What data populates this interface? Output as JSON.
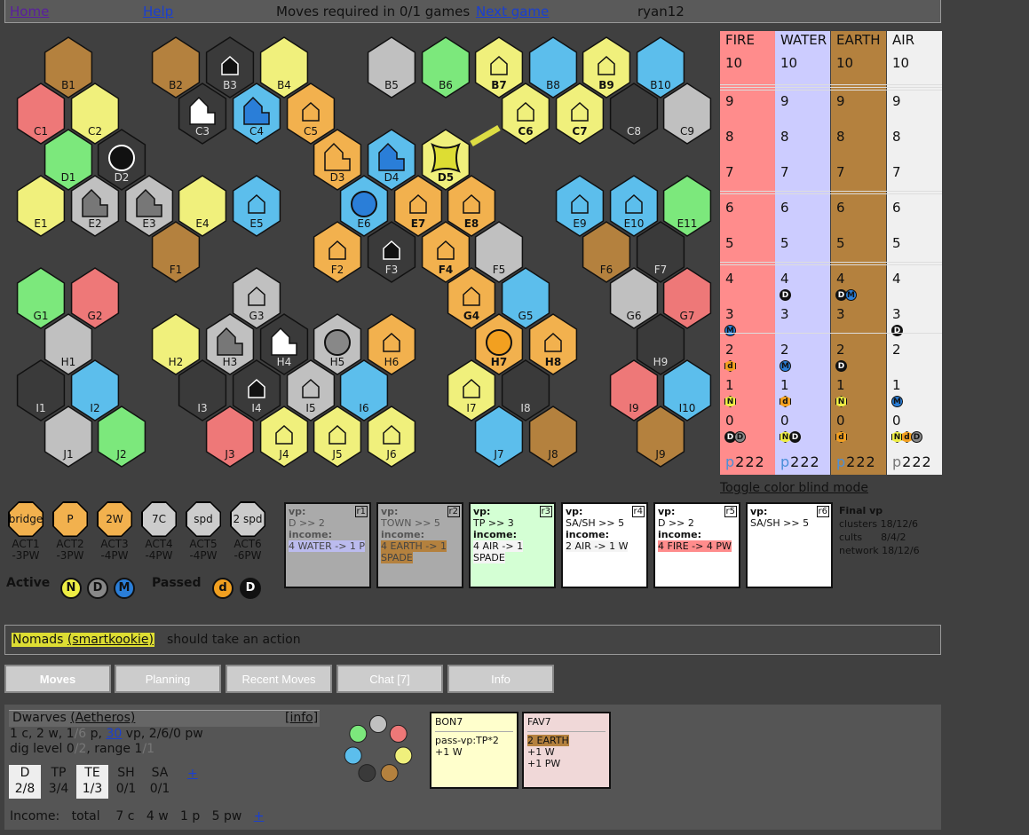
{
  "header": {
    "home": "Home",
    "help": "Help",
    "moves_required": "Moves required in 0/1 games",
    "next_game": "Next game",
    "user": "ryan12"
  },
  "colors": {
    "yellow": "#f0f07c",
    "gray": "#c0c0c0",
    "brown": "#b4813e",
    "black": "#3a3a3a",
    "blue": "#5cbeec",
    "green": "#7ce87c",
    "red": "#ee7878",
    "orange": "#f2b14e"
  },
  "map": {
    "hexes": [
      {
        "id": "B1",
        "c": "brown"
      },
      {
        "id": "B2",
        "c": "brown"
      },
      {
        "id": "B3",
        "c": "black",
        "b": "dwelling"
      },
      {
        "id": "B4",
        "c": "yellow"
      },
      {
        "id": "B5",
        "c": "gray"
      },
      {
        "id": "B6",
        "c": "green"
      },
      {
        "id": "B7",
        "c": "yellow",
        "b": "dwelling",
        "bold": true
      },
      {
        "id": "B8",
        "c": "blue"
      },
      {
        "id": "B9",
        "c": "yellow",
        "b": "dwelling",
        "bold": true
      },
      {
        "id": "B10",
        "c": "blue"
      },
      {
        "id": "C1",
        "c": "red"
      },
      {
        "id": "C2",
        "c": "yellow"
      },
      {
        "id": "C3",
        "c": "black",
        "b": "tp"
      },
      {
        "id": "C4",
        "c": "blue",
        "b": "tp"
      },
      {
        "id": "C5",
        "c": "orange",
        "b": "dwelling"
      },
      {
        "id": "C6",
        "c": "yellow",
        "b": "dwelling",
        "bold": true
      },
      {
        "id": "C7",
        "c": "yellow",
        "b": "dwelling",
        "bold": true
      },
      {
        "id": "C8",
        "c": "black"
      },
      {
        "id": "C9",
        "c": "gray"
      },
      {
        "id": "D1",
        "c": "green"
      },
      {
        "id": "D2",
        "c": "black",
        "b": "sh"
      },
      {
        "id": "D3",
        "c": "orange",
        "b": "tp"
      },
      {
        "id": "D4",
        "c": "blue",
        "b": "tp"
      },
      {
        "id": "D5",
        "c": "yellow",
        "b": "sa",
        "bold": true
      },
      {
        "id": "E1",
        "c": "yellow"
      },
      {
        "id": "E2",
        "c": "gray",
        "b": "tp"
      },
      {
        "id": "E3",
        "c": "gray",
        "b": "tp"
      },
      {
        "id": "E4",
        "c": "yellow"
      },
      {
        "id": "E5",
        "c": "blue",
        "b": "dwelling"
      },
      {
        "id": "E6",
        "c": "blue",
        "b": "sh"
      },
      {
        "id": "E7",
        "c": "orange",
        "b": "dwelling",
        "bold": true
      },
      {
        "id": "E8",
        "c": "orange",
        "b": "dwelling",
        "bold": true
      },
      {
        "id": "E9",
        "c": "blue",
        "b": "dwelling"
      },
      {
        "id": "E10",
        "c": "blue",
        "b": "dwelling"
      },
      {
        "id": "E11",
        "c": "green"
      },
      {
        "id": "F1",
        "c": "brown"
      },
      {
        "id": "F2",
        "c": "orange",
        "b": "dwelling"
      },
      {
        "id": "F3",
        "c": "black",
        "b": "dwelling"
      },
      {
        "id": "F4",
        "c": "orange",
        "b": "dwelling",
        "bold": true
      },
      {
        "id": "F5",
        "c": "gray"
      },
      {
        "id": "F6",
        "c": "brown"
      },
      {
        "id": "F7",
        "c": "black"
      },
      {
        "id": "G1",
        "c": "green"
      },
      {
        "id": "G2",
        "c": "red"
      },
      {
        "id": "G3",
        "c": "gray",
        "b": "dwelling"
      },
      {
        "id": "G4",
        "c": "orange",
        "b": "dwelling",
        "bold": true
      },
      {
        "id": "G5",
        "c": "blue"
      },
      {
        "id": "G6",
        "c": "gray"
      },
      {
        "id": "G7",
        "c": "red"
      },
      {
        "id": "H1",
        "c": "gray"
      },
      {
        "id": "H2",
        "c": "yellow"
      },
      {
        "id": "H3",
        "c": "gray",
        "b": "tp"
      },
      {
        "id": "H4",
        "c": "black",
        "b": "tp"
      },
      {
        "id": "H5",
        "c": "gray",
        "b": "sh"
      },
      {
        "id": "H6",
        "c": "orange",
        "b": "dwelling"
      },
      {
        "id": "H7",
        "c": "orange",
        "b": "sh",
        "bold": true
      },
      {
        "id": "H8",
        "c": "orange",
        "b": "dwelling",
        "bold": true
      },
      {
        "id": "H9",
        "c": "black"
      },
      {
        "id": "I1",
        "c": "black"
      },
      {
        "id": "I2",
        "c": "blue"
      },
      {
        "id": "I3",
        "c": "black"
      },
      {
        "id": "I4",
        "c": "black",
        "b": "dwelling"
      },
      {
        "id": "I5",
        "c": "gray",
        "b": "dwelling"
      },
      {
        "id": "I6",
        "c": "blue"
      },
      {
        "id": "I7",
        "c": "yellow",
        "b": "dwelling"
      },
      {
        "id": "I8",
        "c": "black"
      },
      {
        "id": "I9",
        "c": "red"
      },
      {
        "id": "I10",
        "c": "blue"
      },
      {
        "id": "J1",
        "c": "gray"
      },
      {
        "id": "J2",
        "c": "green"
      },
      {
        "id": "J3",
        "c": "red"
      },
      {
        "id": "J4",
        "c": "yellow",
        "b": "dwelling"
      },
      {
        "id": "J5",
        "c": "yellow",
        "b": "dwelling"
      },
      {
        "id": "J6",
        "c": "yellow",
        "b": "dwelling"
      },
      {
        "id": "J7",
        "c": "blue"
      },
      {
        "id": "J8",
        "c": "brown"
      },
      {
        "id": "J9",
        "c": "brown"
      }
    ]
  },
  "cults": {
    "names": [
      "FIRE",
      "WATER",
      "EARTH",
      "AIR"
    ],
    "levels": [
      "10",
      "10",
      "10",
      "10"
    ],
    "colors": [
      "#ff8c8c",
      "#ccccff",
      "#b4813e",
      "#f0f0f0"
    ],
    "rows": [
      "9",
      "8",
      "7",
      "6",
      "5",
      "4",
      "3",
      "2",
      "1",
      "0"
    ],
    "tokens": [
      [
        "4",
        "WATER",
        "D"
      ],
      [
        "4",
        "EARTH",
        "D"
      ],
      [
        "4",
        "EARTH",
        "M"
      ],
      [
        "3",
        "FIRE",
        "M"
      ],
      [
        "3",
        "AIR",
        "D"
      ],
      [
        "2",
        "FIRE",
        "d"
      ],
      [
        "2",
        "WATER",
        "M"
      ],
      [
        "2",
        "EARTH",
        "D"
      ],
      [
        "1",
        "FIRE",
        "N"
      ],
      [
        "1",
        "WATER",
        "d"
      ],
      [
        "1",
        "EARTH",
        "N"
      ],
      [
        "1",
        "AIR",
        "M"
      ],
      [
        "0",
        "FIRE",
        "D"
      ],
      [
        "0",
        "FIRE",
        "D2"
      ],
      [
        "0",
        "WATER",
        "N"
      ],
      [
        "0",
        "WATER",
        "D"
      ],
      [
        "0",
        "EARTH",
        "d"
      ],
      [
        "0",
        "AIR",
        "N"
      ],
      [
        "0",
        "AIR",
        "d"
      ],
      [
        "0",
        "AIR",
        "D2"
      ]
    ],
    "p_label": "p",
    "p_values": "222"
  },
  "toggle_color_blind": "Toggle color blind mode",
  "actions": [
    {
      "name": "bridge",
      "label": "ACT1",
      "cost": "-3PW",
      "taken": false
    },
    {
      "name": "P",
      "label": "ACT2",
      "cost": "-3PW",
      "taken": false
    },
    {
      "name": "2W",
      "label": "ACT3",
      "cost": "-4PW",
      "taken": false
    },
    {
      "name": "7C",
      "label": "ACT4",
      "cost": "-4PW",
      "taken": true
    },
    {
      "name": "spd",
      "label": "ACT5",
      "cost": "-4PW",
      "taken": true
    },
    {
      "name": "2 spd",
      "label": "ACT6",
      "cost": "-6PW",
      "taken": true
    }
  ],
  "active_label": "Active",
  "passed_label": "Passed",
  "active_tokens": [
    "N",
    "D",
    "M"
  ],
  "passed_tokens": [
    "d",
    "D"
  ],
  "rounds": [
    {
      "id": "r1",
      "vp": "vp:",
      "score": "D >> 2",
      "income_label": "income:",
      "income": "4 WATER -> 1 P",
      "bg": "#aaaaaa"
    },
    {
      "id": "r2",
      "vp": "vp:",
      "score": "TOWN >> 5",
      "income_label": "income:",
      "income": "4 EARTH -> 1 SPADE",
      "bg": "#aaaaaa"
    },
    {
      "id": "r3",
      "vp": "vp:",
      "score": "TP >> 3",
      "income_label": "income:",
      "income": "4 AIR -> 1 SPADE",
      "bg": "#d4ffd4"
    },
    {
      "id": "r4",
      "vp": "vp:",
      "score": "SA/SH >> 5",
      "income_label": "income:",
      "income": "2 AIR -> 1 W",
      "bg": "#ffffff"
    },
    {
      "id": "r5",
      "vp": "vp:",
      "score": "D >> 2",
      "income_label": "income:",
      "income": "4 FIRE -> 4 PW",
      "bg": "#ffffff"
    },
    {
      "id": "r6",
      "vp": "vp:",
      "score": "SA/SH >> 5",
      "income_label": "",
      "income": "",
      "bg": "#ffffff"
    }
  ],
  "final_vp": {
    "title": "Final vp",
    "rows": [
      [
        "clusters",
        "18/12/6"
      ],
      [
        "cults",
        "8/4/2"
      ],
      [
        "network",
        "18/12/6"
      ]
    ]
  },
  "status": {
    "faction": "Nomads",
    "player": "(smartkookie)",
    "message": "should take an action"
  },
  "tabs": [
    "Moves",
    "Planning",
    "Recent Moves",
    "Chat [7]",
    "Info"
  ],
  "player": {
    "faction": "Dwarves",
    "name": "(Aetheros)",
    "info_link": "[info]",
    "res_c": "1 c, 2 w, 1",
    "res_p_max": "/6",
    "res_p_suffix": " p,",
    "vp": "30",
    "vp_suffix": " vp, 2/6/0 pw",
    "dig": "dig level 0",
    "dig_max": "/2",
    "range_label": ", range 1",
    "range_max": "/1",
    "buildings": [
      {
        "n": "D",
        "v": "2/8"
      },
      {
        "n": "TP",
        "v": "3/4"
      },
      {
        "n": "TE",
        "v": "1/3"
      },
      {
        "n": "SH",
        "v": "0/1"
      },
      {
        "n": "SA",
        "v": "0/1"
      }
    ],
    "plus": "+",
    "income_label": "Income:",
    "income_total": "total",
    "income_c": "7 c",
    "income_w": "4 w",
    "income_p": "1 p",
    "income_pw": "5 pw",
    "cycle_colors": [
      "#c0c0c0",
      "#ee7878",
      "#f0f07c",
      "#b4813e",
      "#3a3a3a",
      "#5cbeec",
      "#7ce87c"
    ]
  },
  "bonus_card": {
    "title": "BON7",
    "line1": "pass-vp:TP*2",
    "line2": "+1 W"
  },
  "favor_card": {
    "title": "FAV7",
    "line1": "2 EARTH",
    "line2": "+1 W",
    "line3": "+1 PW"
  }
}
